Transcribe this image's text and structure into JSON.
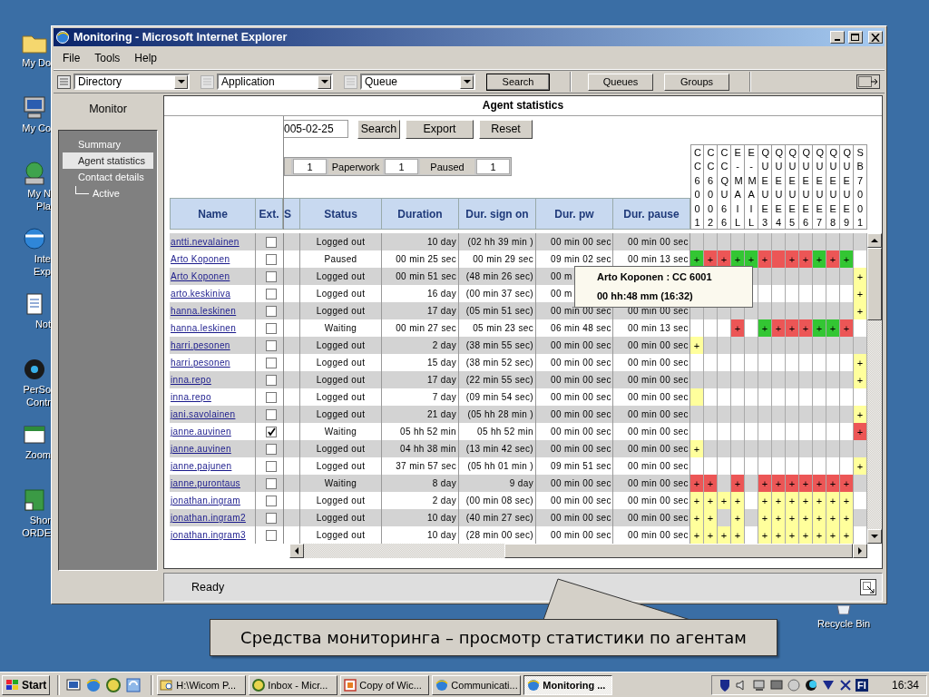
{
  "desktop": {
    "icons": [
      {
        "lines": [
          "My Do"
        ]
      },
      {
        "lines": [
          "My Co"
        ]
      },
      {
        "lines": [
          "My N",
          "Pla"
        ]
      },
      {
        "lines": [
          "Inte",
          "Exp"
        ]
      },
      {
        "lines": [
          "Not"
        ]
      },
      {
        "lines": [
          "PerSo",
          "Contr"
        ]
      },
      {
        "lines": [
          "Zoom"
        ]
      },
      {
        "lines": [
          "Shor",
          "ORDE"
        ]
      }
    ],
    "recycle_bin": "Recycle Bin"
  },
  "window": {
    "title": "Monitoring - Microsoft Internet Explorer",
    "menu": [
      "File",
      "Tools",
      "Help"
    ],
    "toolbar": {
      "dropdowns": [
        "Directory",
        "Application",
        "Queue"
      ],
      "search_button": "Search",
      "buttons": [
        "Queues",
        "Groups"
      ]
    },
    "sidebar": {
      "title": "Monitor",
      "items": [
        {
          "label": "Summary",
          "selected": false
        },
        {
          "label": "Agent statistics",
          "selected": true
        },
        {
          "label": "Contact details",
          "selected": false,
          "children": [
            {
              "label": "Active",
              "selected": false
            }
          ]
        }
      ]
    },
    "panel_title": "Agent statistics",
    "filter": {
      "date": "005-02-25",
      "buttons": [
        "Search",
        "Export",
        "Reset"
      ],
      "counts": [
        {
          "value": "1"
        },
        {
          "label": "Paperwork",
          "value": "1"
        },
        {
          "label": "Paused",
          "value": "1"
        }
      ]
    },
    "table": {
      "columns": [
        "Name",
        "Ext.",
        "S",
        "Status",
        "Duration",
        "Dur. sign on",
        "Dur. pw",
        "Dur. pause"
      ],
      "queue_columns": [
        "CC6001",
        "CC6002",
        "CCQU66",
        "E-MAIL",
        "E-MAIL",
        "QUEUE3",
        "QUEUE4",
        "QUEUE5",
        "QUEUE6",
        "QUEUE7",
        "QUEUE8",
        "QUEUE9",
        "SB7001"
      ],
      "rows": [
        {
          "name": "antti.nevalainen",
          "ext_checked": false,
          "status": "Logged out",
          "duration": "10 day",
          "dur_sign_on": "(02 hh 39 min )",
          "dur_pw": "00 min 00 sec",
          "dur_pause": "00 min 00 sec",
          "queues": [
            {
              "kind": "blank"
            },
            {
              "kind": "blank"
            },
            {
              "kind": "blank"
            },
            {
              "kind": "blank"
            },
            {
              "kind": "blank"
            },
            {
              "kind": "blank"
            },
            {
              "kind": "blank"
            },
            {
              "kind": "blank"
            },
            {
              "kind": "blank"
            },
            {
              "kind": "blank"
            },
            {
              "kind": "blank"
            },
            {
              "kind": "blank"
            },
            {
              "kind": "blank"
            }
          ]
        },
        {
          "name": "Arto Koponen",
          "ext_checked": false,
          "status": "Paused",
          "duration": "00 min 25 sec",
          "dur_sign_on": "00 min 29 sec",
          "dur_pw": "09 min 02 sec",
          "dur_pause": "00 min 13 sec",
          "queues": [
            {
              "kind": "flag",
              "color": "#33c633",
              "text": "+"
            },
            {
              "kind": "flag",
              "color": "#ec5656",
              "text": "+"
            },
            {
              "kind": "flag",
              "color": "#ec5656",
              "text": "+"
            },
            {
              "kind": "flag",
              "color": "#33c633",
              "text": "+"
            },
            {
              "kind": "flag",
              "color": "#33c633",
              "text": "+"
            },
            {
              "kind": "flag",
              "color": "#ec5656",
              "text": "+"
            },
            {
              "kind": "flag",
              "color": "#ec5656"
            },
            {
              "kind": "flag",
              "color": "#ec5656",
              "text": "+"
            },
            {
              "kind": "flag",
              "color": "#ec5656",
              "text": "+"
            },
            {
              "kind": "flag",
              "color": "#33c633",
              "text": "+"
            },
            {
              "kind": "flag",
              "color": "#ec5656",
              "text": "+"
            },
            {
              "kind": "flag",
              "color": "#33c633",
              "text": "+"
            },
            {
              "kind": "blank"
            }
          ]
        },
        {
          "name": "Arto Koponen",
          "ext_checked": false,
          "status": "Logged out",
          "duration": "00 min 51 sec",
          "dur_sign_on": "(48 min 26 sec)",
          "dur_pw": "00 m",
          "queues": [
            {
              "kind": "blank"
            },
            {
              "kind": "blank"
            },
            {
              "kind": "blank"
            },
            {
              "kind": "blank"
            },
            {
              "kind": "blank"
            },
            {
              "kind": "blank"
            },
            {
              "kind": "blank"
            },
            {
              "kind": "blank"
            },
            {
              "kind": "blank"
            },
            {
              "kind": "blank"
            },
            {
              "kind": "blank"
            },
            {
              "kind": "blank"
            },
            {
              "kind": "flag",
              "color": "#ffff9c",
              "text": "+"
            }
          ]
        },
        {
          "name": "arto.keskiniva",
          "ext_checked": false,
          "status": "Logged out",
          "duration": "16 day",
          "dur_sign_on": "(00 min 37 sec)",
          "dur_pw": "00 m",
          "queues": [
            {
              "kind": "blank"
            },
            {
              "kind": "blank"
            },
            {
              "kind": "blank"
            },
            {
              "kind": "blank"
            },
            {
              "kind": "blank"
            },
            {
              "kind": "blank"
            },
            {
              "kind": "blank"
            },
            {
              "kind": "blank"
            },
            {
              "kind": "blank"
            },
            {
              "kind": "blank"
            },
            {
              "kind": "blank"
            },
            {
              "kind": "blank"
            },
            {
              "kind": "flag",
              "color": "#ffff9c",
              "text": "+"
            }
          ]
        },
        {
          "name": "hanna.leskinen",
          "ext_checked": false,
          "status": "Logged out",
          "duration": "17 day",
          "dur_sign_on": "(05 min 51 sec)",
          "dur_pw": "00 min 00 sec",
          "dur_pause": "00 min 00 sec",
          "queues": [
            {
              "kind": "blank"
            },
            {
              "kind": "blank"
            },
            {
              "kind": "blank"
            },
            {
              "kind": "blank"
            },
            {
              "kind": "blank"
            },
            {
              "kind": "blank"
            },
            {
              "kind": "blank"
            },
            {
              "kind": "blank"
            },
            {
              "kind": "blank"
            },
            {
              "kind": "blank"
            },
            {
              "kind": "blank"
            },
            {
              "kind": "blank"
            },
            {
              "kind": "flag",
              "color": "#ffff9c",
              "text": "+"
            }
          ]
        },
        {
          "name": "hanna.leskinen",
          "ext_checked": false,
          "status": "Waiting",
          "duration": "00 min 27 sec",
          "dur_sign_on": "05 min 23 sec",
          "dur_pw": "06 min 48 sec",
          "dur_pause": "00 min 13 sec",
          "queues": [
            {
              "kind": "blank"
            },
            {
              "kind": "blank"
            },
            {
              "kind": "blank"
            },
            {
              "kind": "flag",
              "color": "#ec5656",
              "text": "+"
            },
            {
              "kind": "blank"
            },
            {
              "kind": "flag",
              "color": "#33c633",
              "text": "+"
            },
            {
              "kind": "flag",
              "color": "#ec5656",
              "text": "+"
            },
            {
              "kind": "flag",
              "color": "#ec5656",
              "text": "+"
            },
            {
              "kind": "flag",
              "color": "#ec5656",
              "text": "+"
            },
            {
              "kind": "flag",
              "color": "#33c633",
              "text": "+"
            },
            {
              "kind": "flag",
              "color": "#33c633",
              "text": "+"
            },
            {
              "kind": "flag",
              "color": "#ec5656",
              "text": "+"
            },
            {
              "kind": "blank"
            }
          ]
        },
        {
          "name": "harri.pesonen",
          "ext_checked": false,
          "status": "Logged out",
          "duration": "2 day",
          "dur_sign_on": "(38 min 55 sec)",
          "dur_pw": "00 min 00 sec",
          "dur_pause": "00 min 00 sec",
          "queues": [
            {
              "kind": "flag",
              "color": "#ffff9c",
              "text": "+"
            },
            {
              "kind": "blank"
            },
            {
              "kind": "blank"
            },
            {
              "kind": "blank"
            },
            {
              "kind": "blank"
            },
            {
              "kind": "blank"
            },
            {
              "kind": "blank"
            },
            {
              "kind": "blank"
            },
            {
              "kind": "blank"
            },
            {
              "kind": "blank"
            },
            {
              "kind": "blank"
            },
            {
              "kind": "blank"
            },
            {
              "kind": "blank"
            }
          ]
        },
        {
          "name": "harri.pesonen",
          "ext_checked": false,
          "status": "Logged out",
          "duration": "15 day",
          "dur_sign_on": "(38 min 52 sec)",
          "dur_pw": "00 min 00 sec",
          "dur_pause": "00 min 00 sec",
          "queues": [
            {
              "kind": "blank"
            },
            {
              "kind": "blank"
            },
            {
              "kind": "blank"
            },
            {
              "kind": "blank"
            },
            {
              "kind": "blank"
            },
            {
              "kind": "blank"
            },
            {
              "kind": "blank"
            },
            {
              "kind": "blank"
            },
            {
              "kind": "blank"
            },
            {
              "kind": "blank"
            },
            {
              "kind": "blank"
            },
            {
              "kind": "blank"
            },
            {
              "kind": "flag",
              "color": "#ffff9c",
              "text": "+"
            }
          ]
        },
        {
          "name": "inna.repo",
          "ext_checked": false,
          "status": "Logged out",
          "duration": "17 day",
          "dur_sign_on": "(22 min 55 sec)",
          "dur_pw": "00 min 00 sec",
          "dur_pause": "00 min 00 sec",
          "queues": [
            {
              "kind": "blank"
            },
            {
              "kind": "blank"
            },
            {
              "kind": "blank"
            },
            {
              "kind": "blank"
            },
            {
              "kind": "blank"
            },
            {
              "kind": "blank"
            },
            {
              "kind": "blank"
            },
            {
              "kind": "blank"
            },
            {
              "kind": "blank"
            },
            {
              "kind": "blank"
            },
            {
              "kind": "blank"
            },
            {
              "kind": "blank"
            },
            {
              "kind": "flag",
              "color": "#ffff9c",
              "text": "+"
            }
          ]
        },
        {
          "name": "inna.repo",
          "ext_checked": false,
          "status": "Logged out",
          "duration": "7 day",
          "dur_sign_on": "(09 min 54 sec)",
          "dur_pw": "00 min 00 sec",
          "dur_pause": "00 min 00 sec",
          "queues": [
            {
              "kind": "flag",
              "color": "#ffff9c"
            },
            {
              "kind": "blank"
            },
            {
              "kind": "blank"
            },
            {
              "kind": "blank"
            },
            {
              "kind": "blank"
            },
            {
              "kind": "blank"
            },
            {
              "kind": "blank"
            },
            {
              "kind": "blank"
            },
            {
              "kind": "blank"
            },
            {
              "kind": "blank"
            },
            {
              "kind": "blank"
            },
            {
              "kind": "blank"
            },
            {
              "kind": "blank"
            }
          ]
        },
        {
          "name": "jani.savolainen",
          "ext_checked": false,
          "status": "Logged out",
          "duration": "21 day",
          "dur_sign_on": "(05 hh 28 min )",
          "dur_pw": "00 min 00 sec",
          "dur_pause": "00 min 00 sec",
          "queues": [
            {
              "kind": "blank"
            },
            {
              "kind": "blank"
            },
            {
              "kind": "blank"
            },
            {
              "kind": "blank"
            },
            {
              "kind": "blank"
            },
            {
              "kind": "blank"
            },
            {
              "kind": "blank"
            },
            {
              "kind": "blank"
            },
            {
              "kind": "blank"
            },
            {
              "kind": "blank"
            },
            {
              "kind": "blank"
            },
            {
              "kind": "blank"
            },
            {
              "kind": "flag",
              "color": "#ffff9c",
              "text": "+"
            }
          ]
        },
        {
          "name": "janne.auvinen",
          "ext_checked": true,
          "status": "Waiting",
          "duration": "05 hh 52 min",
          "dur_sign_on": "05 hh 52 min",
          "dur_pw": "00 min 00 sec",
          "dur_pause": "00 min 00 sec",
          "queues": [
            {
              "kind": "blank"
            },
            {
              "kind": "blank"
            },
            {
              "kind": "blank"
            },
            {
              "kind": "blank"
            },
            {
              "kind": "blank"
            },
            {
              "kind": "blank"
            },
            {
              "kind": "blank"
            },
            {
              "kind": "blank"
            },
            {
              "kind": "blank"
            },
            {
              "kind": "blank"
            },
            {
              "kind": "blank"
            },
            {
              "kind": "blank"
            },
            {
              "kind": "flag",
              "color": "#ec5656",
              "text": "+"
            }
          ]
        },
        {
          "name": "janne.auvinen",
          "ext_checked": false,
          "status": "Logged out",
          "duration": "04 hh 38 min",
          "dur_sign_on": "(13 min 42 sec)",
          "dur_pw": "00 min 00 sec",
          "dur_pause": "00 min 00 sec",
          "queues": [
            {
              "kind": "flag",
              "color": "#ffff9c",
              "text": "+"
            },
            {
              "kind": "blank"
            },
            {
              "kind": "blank"
            },
            {
              "kind": "blank"
            },
            {
              "kind": "blank"
            },
            {
              "kind": "blank"
            },
            {
              "kind": "blank"
            },
            {
              "kind": "blank"
            },
            {
              "kind": "blank"
            },
            {
              "kind": "blank"
            },
            {
              "kind": "blank"
            },
            {
              "kind": "blank"
            },
            {
              "kind": "blank"
            }
          ]
        },
        {
          "name": "janne.pajunen",
          "ext_checked": false,
          "status": "Logged out",
          "duration": "37 min 57 sec",
          "dur_sign_on": "(05 hh 01 min )",
          "dur_pw": "09 min 51 sec",
          "dur_pause": "00 min 00 sec",
          "queues": [
            {
              "kind": "blank"
            },
            {
              "kind": "blank"
            },
            {
              "kind": "blank"
            },
            {
              "kind": "blank"
            },
            {
              "kind": "blank"
            },
            {
              "kind": "blank"
            },
            {
              "kind": "blank"
            },
            {
              "kind": "blank"
            },
            {
              "kind": "blank"
            },
            {
              "kind": "blank"
            },
            {
              "kind": "blank"
            },
            {
              "kind": "blank"
            },
            {
              "kind": "flag",
              "color": "#ffff9c",
              "text": "+"
            }
          ]
        },
        {
          "name": "janne.purontaus",
          "ext_checked": false,
          "status": "Waiting",
          "duration": "8 day",
          "dur_sign_on": "9 day",
          "dur_pw": "00 min 00 sec",
          "dur_pause": "00 min 00 sec",
          "queues": [
            {
              "kind": "flag",
              "color": "#ec5656",
              "text": "+"
            },
            {
              "kind": "flag",
              "color": "#ec5656",
              "text": "+"
            },
            {
              "kind": "blank"
            },
            {
              "kind": "flag",
              "color": "#ec5656",
              "text": "+"
            },
            {
              "kind": "blank"
            },
            {
              "kind": "flag",
              "color": "#ec5656",
              "text": "+"
            },
            {
              "kind": "flag",
              "color": "#ec5656",
              "text": "+"
            },
            {
              "kind": "flag",
              "color": "#ec5656",
              "text": "+"
            },
            {
              "kind": "flag",
              "color": "#ec5656",
              "text": "+"
            },
            {
              "kind": "flag",
              "color": "#ec5656",
              "text": "+"
            },
            {
              "kind": "flag",
              "color": "#ec5656",
              "text": "+"
            },
            {
              "kind": "flag",
              "color": "#ec5656",
              "text": "+"
            },
            {
              "kind": "blank"
            }
          ]
        },
        {
          "name": "jonathan.ingram",
          "ext_checked": false,
          "status": "Logged out",
          "duration": "2 day",
          "dur_sign_on": "(00 min 08 sec)",
          "dur_pw": "00 min 00 sec",
          "dur_pause": "00 min 00 sec",
          "queues": [
            {
              "kind": "flag",
              "color": "#ffff9c",
              "text": "+"
            },
            {
              "kind": "flag",
              "color": "#ffff9c",
              "text": "+"
            },
            {
              "kind": "flag",
              "color": "#ffff9c",
              "text": "+"
            },
            {
              "kind": "flag",
              "color": "#ffff9c",
              "text": "+"
            },
            {
              "kind": "blank"
            },
            {
              "kind": "flag",
              "color": "#ffff9c",
              "text": "+"
            },
            {
              "kind": "flag",
              "color": "#ffff9c",
              "text": "+"
            },
            {
              "kind": "flag",
              "color": "#ffff9c",
              "text": "+"
            },
            {
              "kind": "flag",
              "color": "#ffff9c",
              "text": "+"
            },
            {
              "kind": "flag",
              "color": "#ffff9c",
              "text": "+"
            },
            {
              "kind": "flag",
              "color": "#ffff9c",
              "text": "+"
            },
            {
              "kind": "flag",
              "color": "#ffff9c",
              "text": "+"
            },
            {
              "kind": "blank"
            }
          ]
        },
        {
          "name": "jonathan.ingram2",
          "ext_checked": false,
          "status": "Logged out",
          "duration": "10 day",
          "dur_sign_on": "(40 min 27 sec)",
          "dur_pw": "00 min 00 sec",
          "dur_pause": "00 min 00 sec",
          "queues": [
            {
              "kind": "flag",
              "color": "#ffff9c",
              "text": "+"
            },
            {
              "kind": "flag",
              "color": "#ffff9c",
              "text": "+"
            },
            {
              "kind": "blank"
            },
            {
              "kind": "flag",
              "color": "#ffff9c",
              "text": "+"
            },
            {
              "kind": "blank"
            },
            {
              "kind": "flag",
              "color": "#ffff9c",
              "text": "+"
            },
            {
              "kind": "flag",
              "color": "#ffff9c",
              "text": "+"
            },
            {
              "kind": "flag",
              "color": "#ffff9c",
              "text": "+"
            },
            {
              "kind": "flag",
              "color": "#ffff9c",
              "text": "+"
            },
            {
              "kind": "flag",
              "color": "#ffff9c",
              "text": "+"
            },
            {
              "kind": "flag",
              "color": "#ffff9c",
              "text": "+"
            },
            {
              "kind": "flag",
              "color": "#ffff9c",
              "text": "+"
            },
            {
              "kind": "blank"
            }
          ]
        },
        {
          "name": "jonathan.ingram3",
          "ext_checked": false,
          "status": "Logged out",
          "duration": "10 day",
          "dur_sign_on": "(28 min 00 sec)",
          "dur_pw": "00 min 00 sec",
          "dur_pause": "00 min 00 sec",
          "queues": [
            {
              "kind": "flag",
              "color": "#ffff9c",
              "text": "+"
            },
            {
              "kind": "flag",
              "color": "#ffff9c",
              "text": "+"
            },
            {
              "kind": "flag",
              "color": "#ffff9c",
              "text": "+"
            },
            {
              "kind": "flag",
              "color": "#ffff9c",
              "text": "+"
            },
            {
              "kind": "blank"
            },
            {
              "kind": "flag",
              "color": "#ffff9c",
              "text": "+"
            },
            {
              "kind": "flag",
              "color": "#ffff9c",
              "text": "+"
            },
            {
              "kind": "flag",
              "color": "#ffff9c",
              "text": "+"
            },
            {
              "kind": "flag",
              "color": "#ffff9c",
              "text": "+"
            },
            {
              "kind": "flag",
              "color": "#ffff9c",
              "text": "+"
            },
            {
              "kind": "flag",
              "color": "#ffff9c",
              "text": "+"
            },
            {
              "kind": "flag",
              "color": "#ffff9c",
              "text": "+"
            },
            {
              "kind": "blank"
            }
          ]
        }
      ]
    },
    "tooltip": [
      "Arto Koponen : CC 6001",
      "00 hh:48 mm (16:32)"
    ],
    "status_bar": "Ready"
  },
  "callout": "Средства мониторинга – просмотр статистики по агентам",
  "taskbar": {
    "start": "Start",
    "tasks": [
      {
        "label": "H:\\Wicom P...",
        "selected": false
      },
      {
        "label": "Inbox - Micr...",
        "selected": false
      },
      {
        "label": "Copy of Wic...",
        "selected": false
      },
      {
        "label": "Communicati...",
        "selected": false
      },
      {
        "label": "Monitoring ...",
        "selected": true
      }
    ],
    "language": "FI",
    "clock": "16:34"
  }
}
